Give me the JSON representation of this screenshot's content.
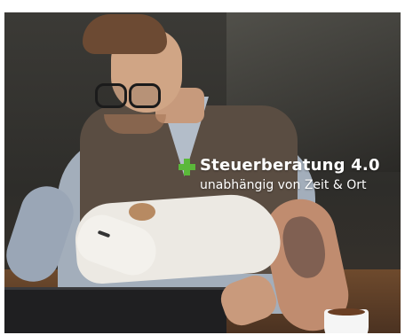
{
  "hero": {
    "headline": "Steuerberatung 4.0",
    "subline": "unabhängig von Zeit & Ort",
    "icon": "plus-icon",
    "accent_color": "#5bb83a",
    "text_color": "#ffffff"
  }
}
